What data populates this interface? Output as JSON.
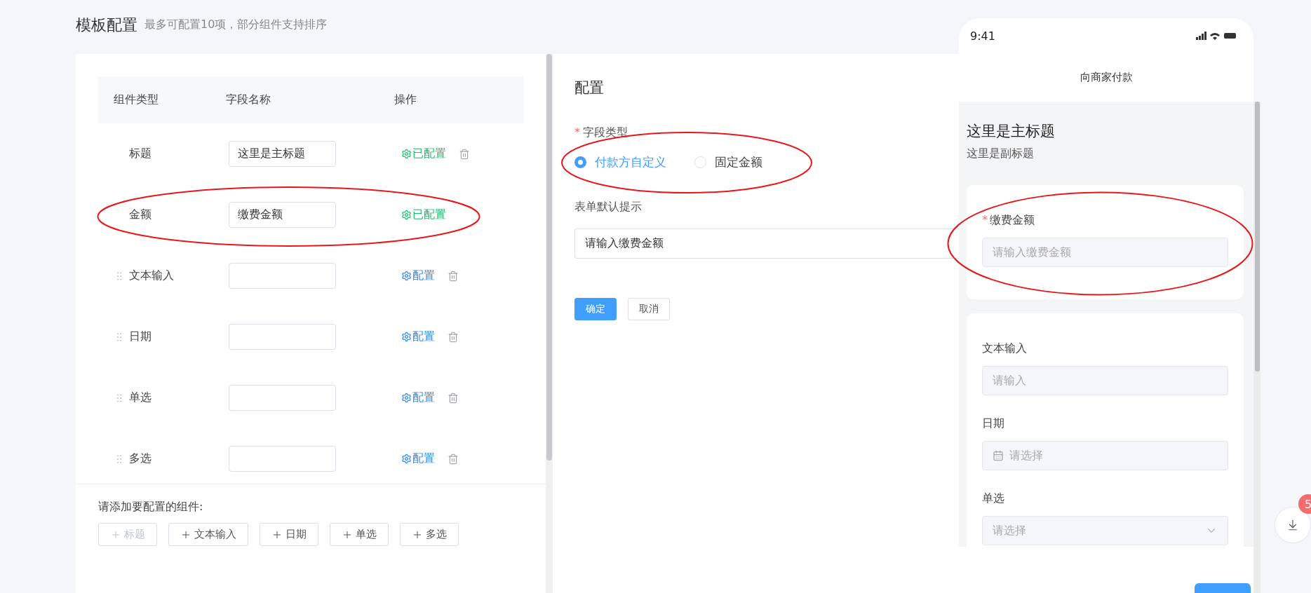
{
  "page": {
    "title": "模板配置",
    "subtitle": "最多可配置10项，部分组件支持排序"
  },
  "table": {
    "columns": [
      "组件类型",
      "字段名称",
      "操作"
    ],
    "rows": [
      {
        "kind": "fixed",
        "type": "标题",
        "field": "这里是主标题",
        "action": "已配置",
        "configured": true
      },
      {
        "kind": "locked",
        "type": "金额",
        "field": "缴费金额",
        "action": "已配置",
        "configured": true
      },
      {
        "kind": "sortable",
        "type": "文本输入",
        "action": "配置",
        "configured": false
      },
      {
        "kind": "sortable",
        "type": "日期",
        "action": "配置",
        "configured": false
      },
      {
        "kind": "sortable",
        "type": "单选",
        "action": "配置",
        "configured": false
      },
      {
        "kind": "sortable",
        "type": "多选",
        "action": "配置",
        "configured": false
      }
    ]
  },
  "add_section": {
    "label": "请添加要配置的组件:",
    "buttons": [
      {
        "label": "标题",
        "disabled": true
      },
      {
        "label": "文本输入",
        "disabled": false
      },
      {
        "label": "日期",
        "disabled": false
      },
      {
        "label": "单选",
        "disabled": false
      },
      {
        "label": "多选",
        "disabled": false
      }
    ]
  },
  "config": {
    "title": "配置",
    "field_type": {
      "label": "字段类型",
      "required_mark": "*",
      "options": [
        {
          "label": "付款方自定义",
          "selected": true
        },
        {
          "label": "固定金额",
          "selected": false
        }
      ]
    },
    "hint": {
      "label": "表单默认提示",
      "value": "请输入缴费金额"
    },
    "buttons": [
      {
        "label": "确定",
        "kind": "primary"
      },
      {
        "label": "取消",
        "kind": "default"
      }
    ]
  },
  "phone": {
    "time": "9:41",
    "nav_title": "向商家付款",
    "title": "这里是主标题",
    "subtitle": "这里是副标题",
    "cards": [
      {
        "fields": [
          {
            "label": "缴费金额",
            "required_mark": "*",
            "kind": "text",
            "placeholder": "请输入缴费金额"
          }
        ]
      },
      {
        "fields": [
          {
            "label": "文本输入",
            "kind": "text",
            "placeholder": "请输入"
          },
          {
            "label": "日期",
            "kind": "date",
            "placeholder": "请选择"
          },
          {
            "label": "单选",
            "kind": "select",
            "placeholder": "请选择"
          }
        ]
      }
    ]
  },
  "download": {
    "badge": "5"
  }
}
